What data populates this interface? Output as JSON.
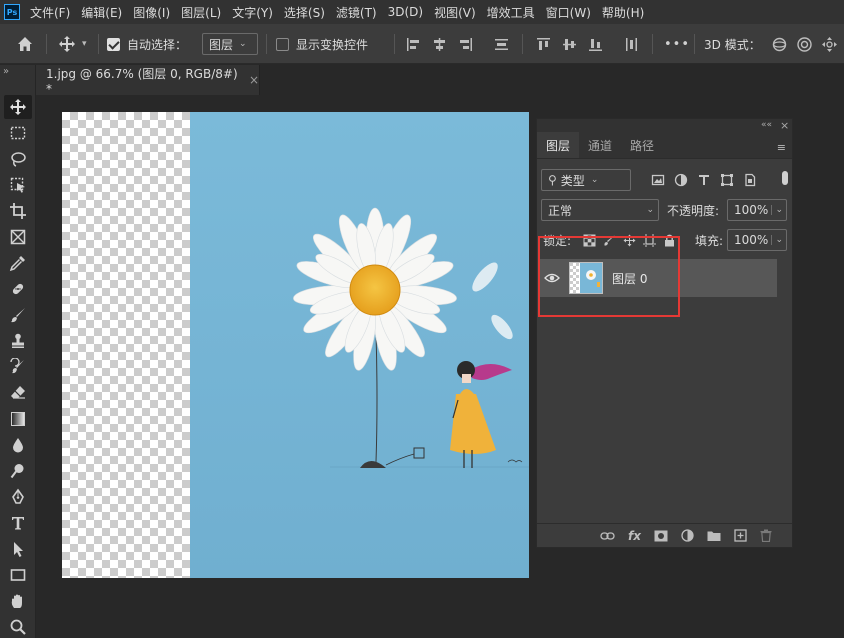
{
  "app": {
    "logo": "Ps"
  },
  "menu": [
    "文件(F)",
    "编辑(E)",
    "图像(I)",
    "图层(L)",
    "文字(Y)",
    "选择(S)",
    "滤镜(T)",
    "3D(D)",
    "视图(V)",
    "增效工具",
    "窗口(W)",
    "帮助(H)"
  ],
  "options": {
    "auto_select_label": "自动选择：",
    "auto_select_checked": true,
    "auto_select_target": "图层",
    "show_transform_label": "显示变换控件",
    "show_transform_checked": false,
    "more": "•••",
    "mode_3d_label": "3D 模式："
  },
  "document_tab": {
    "title": "1.jpg @ 66.7% (图层 0, RGB/8#) *",
    "close": "×"
  },
  "toolbar": {
    "expand": "»"
  },
  "layers_panel": {
    "collapse": "««",
    "close": "×",
    "tabs": [
      "图层",
      "通道",
      "路径"
    ],
    "filter_kind": "类型",
    "blend_mode": "正常",
    "opacity_label": "不透明度:",
    "opacity_value": "100%",
    "lock_label": "锁定:",
    "fill_label": "填充:",
    "fill_value": "100%",
    "layers": [
      {
        "name": "图层 0",
        "visible": true
      }
    ],
    "footer_fx": "fx"
  },
  "colors": {
    "accent": "#31a8ff",
    "highlight": "#e53935",
    "sky": "#74b4d4"
  }
}
